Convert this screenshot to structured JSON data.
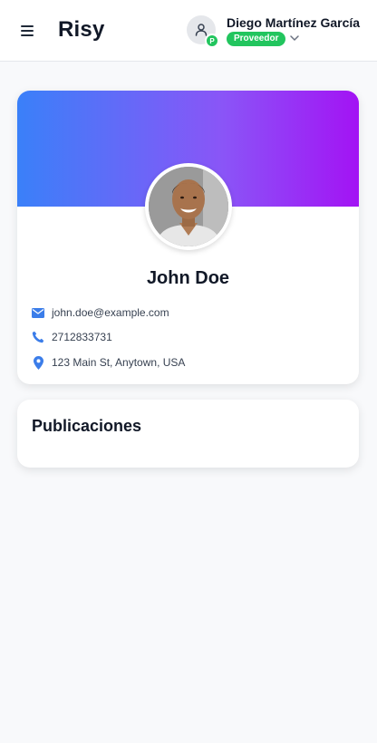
{
  "app": {
    "logo": "Risy",
    "menu_icon": "hamburger-icon"
  },
  "user": {
    "name": "Diego Martínez García",
    "avatar_badge": "P",
    "role": "Proveedor",
    "avatar_icon": "user-icon",
    "dropdown_icon": "chevron-down-icon"
  },
  "profile": {
    "name": "John Doe",
    "email": "john.doe@example.com",
    "phone": "2712833731",
    "address": "123 Main St, Anytown, USA",
    "icons": [
      "envelope-icon",
      "phone-icon",
      "map-pin-icon"
    ]
  },
  "publications": {
    "title": "Publicaciones"
  },
  "colors": {
    "accent_blue": "#3a80f9",
    "accent_purple": "#a313f4",
    "role_green": "#22c55e",
    "background": "#f8f9fb"
  }
}
